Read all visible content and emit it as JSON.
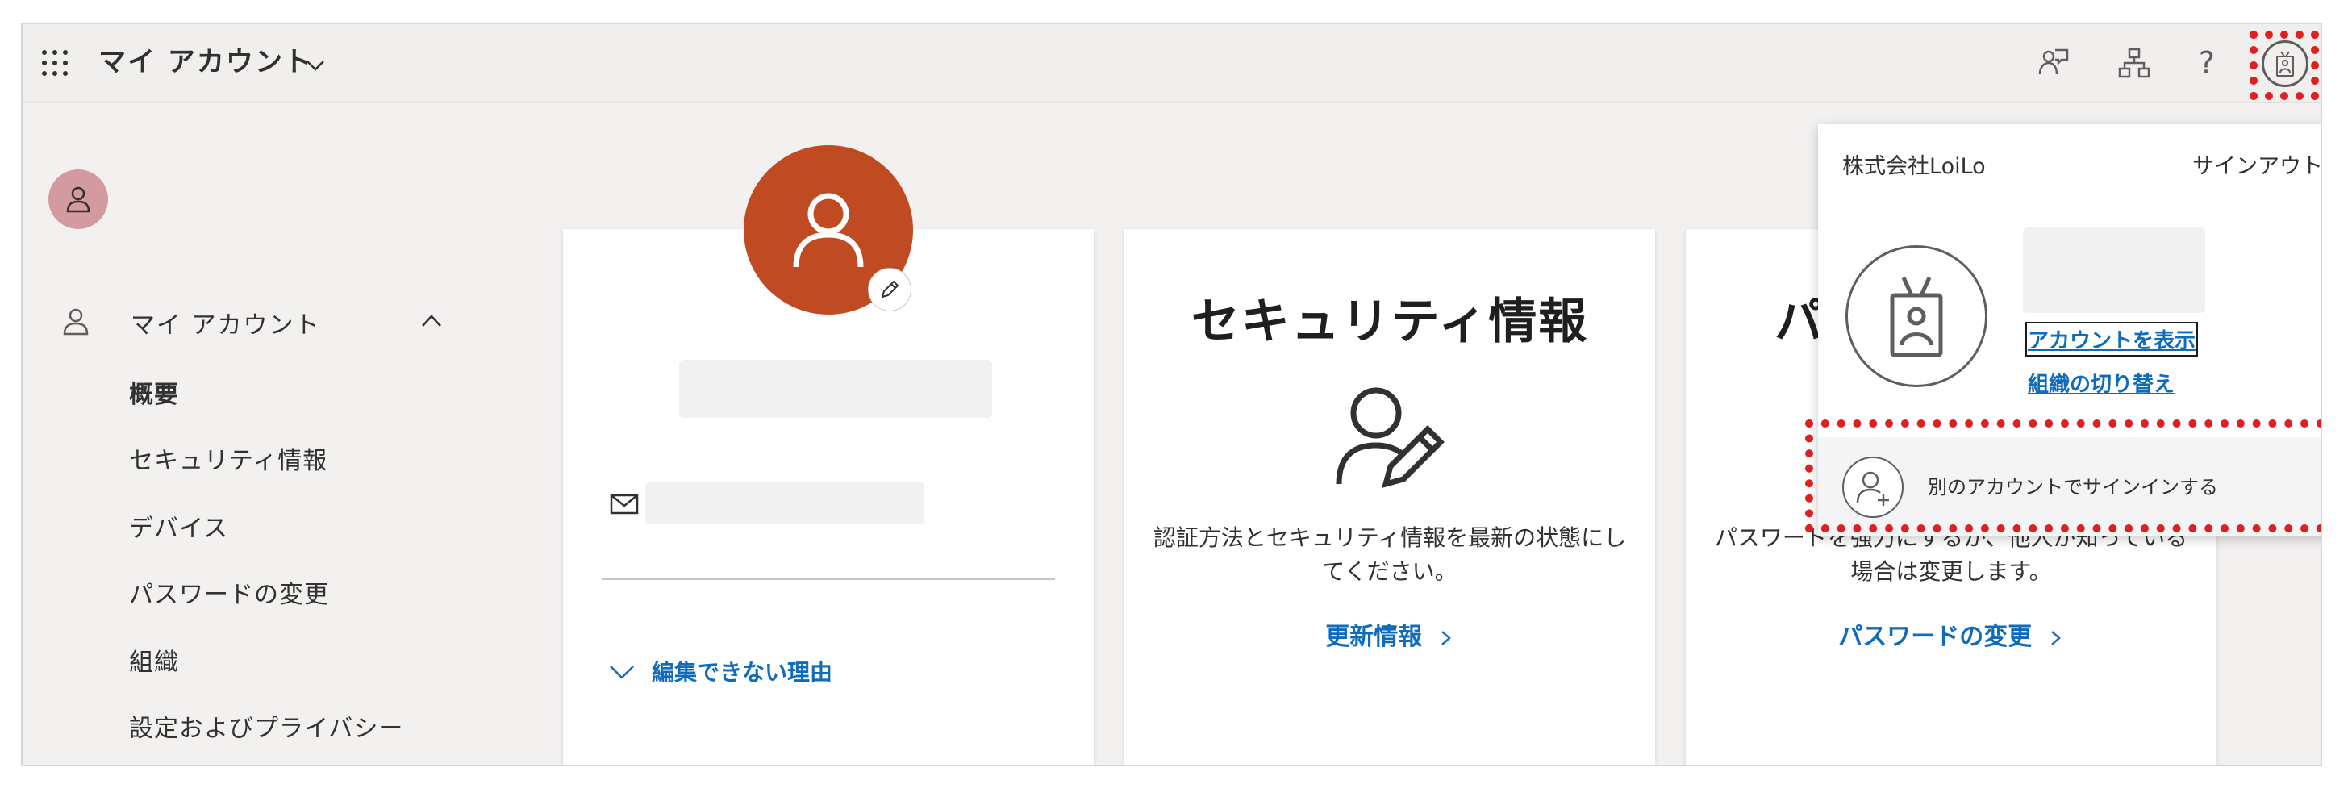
{
  "header": {
    "title": "マイ アカウント",
    "help_glyph": "?"
  },
  "sidebar": {
    "section_label": "マイ アカウント",
    "items": [
      {
        "label": "概要",
        "active": true
      },
      {
        "label": "セキュリティ情報",
        "active": false
      },
      {
        "label": "デバイス",
        "active": false
      },
      {
        "label": "パスワードの変更",
        "active": false
      },
      {
        "label": "組織",
        "active": false
      },
      {
        "label": "設定およびプライバシー",
        "active": false
      }
    ]
  },
  "profile_card": {
    "cant_edit_link": "編集できない理由"
  },
  "security_card": {
    "title": "セキュリティ情報",
    "body": "認証方法とセキュリティ情報を最新の状態にしてください。",
    "link": "更新情報"
  },
  "password_card": {
    "title_fragment": "パ",
    "body": "パスワードを強力にするか、他人が知っている場合は変更します。",
    "link": "パスワードの変更"
  },
  "account_popup": {
    "org_name": "株式会社LoiLo",
    "sign_out": "サインアウト",
    "view_account": "アカウントを表示",
    "switch_org": "組織の切り替え",
    "sign_in_other": "別のアカウントでサインインする"
  },
  "colors": {
    "accent_link": "#0f6cbd",
    "profile_avatar": "#c04a21",
    "sidebar_avatar": "#d39ba0",
    "highlight_dotted": "#e02020"
  },
  "icons": [
    "waffle-icon",
    "chevron-down-icon",
    "feedback-icon",
    "org-chart-icon",
    "help-icon",
    "badge-icon",
    "person-icon",
    "chevron-up-icon",
    "pencil-icon",
    "mail-icon",
    "person-edit-icon",
    "chevron-right-icon",
    "person-add-icon"
  ]
}
